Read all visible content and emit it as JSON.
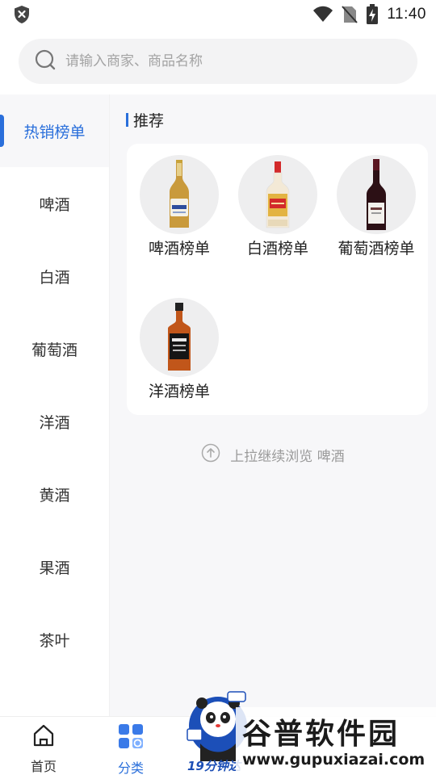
{
  "status_bar": {
    "time": "11:40",
    "icons": [
      "shield-icon",
      "wifi-icon",
      "no-sim-icon",
      "battery-charging-icon"
    ]
  },
  "search": {
    "placeholder": "请输入商家、商品名称"
  },
  "sidebar": {
    "items": [
      {
        "label": "热销榜单",
        "active": true
      },
      {
        "label": "啤酒"
      },
      {
        "label": "白酒"
      },
      {
        "label": "葡萄酒"
      },
      {
        "label": "洋酒"
      },
      {
        "label": "黄酒"
      },
      {
        "label": "果酒"
      },
      {
        "label": "茶叶"
      }
    ]
  },
  "main": {
    "section_title": "推荐",
    "tiles": [
      {
        "label": "啤酒榜单",
        "icon": "beer-bottle-icon"
      },
      {
        "label": "白酒榜单",
        "icon": "baijiu-bottle-icon"
      },
      {
        "label": "葡萄酒榜单",
        "icon": "wine-bottle-icon"
      },
      {
        "label": "洋酒榜单",
        "icon": "whiskey-bottle-icon"
      }
    ],
    "hint": "上拉继续浏览 啤酒"
  },
  "bottom_nav": {
    "items": [
      {
        "label": "首页",
        "icon": "home-icon"
      },
      {
        "label": "分类",
        "icon": "category-icon",
        "active": true
      }
    ],
    "promo_text": "19分钟达"
  },
  "watermark": {
    "title": "谷普软件园",
    "url": "www.gupuxiazai.com"
  },
  "colors": {
    "accent": "#2a6fdb",
    "background": "#f7f7f9"
  }
}
